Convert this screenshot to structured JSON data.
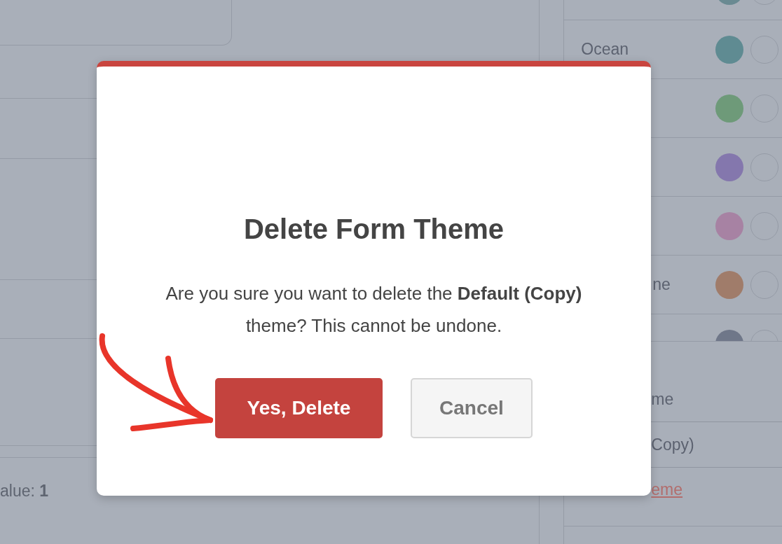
{
  "background": {
    "theme_list": [
      {
        "color": "#6a8a92"
      },
      {
        "label": "Ocean",
        "color": "#5f8b92"
      },
      {
        "color": "#6e9a79"
      },
      {
        "color": "#8477ad"
      },
      {
        "color": "#a782a3"
      },
      {
        "label": "ne",
        "cut": true,
        "color": "#a07c6a"
      },
      {
        "color": "#6f7789"
      }
    ],
    "fields": [
      "me",
      "Copy)"
    ],
    "link": "eme",
    "value_text": "alue: **1**"
  },
  "dialog": {
    "title": "Delete Form Theme",
    "message": "Are you sure you want to delete the **Default (Copy)** theme? This cannot be undone.",
    "buttons": [
      {
        "label": "Yes, Delete",
        "kind": "danger"
      },
      {
        "label": "Cancel",
        "kind": "secondary"
      }
    ]
  }
}
